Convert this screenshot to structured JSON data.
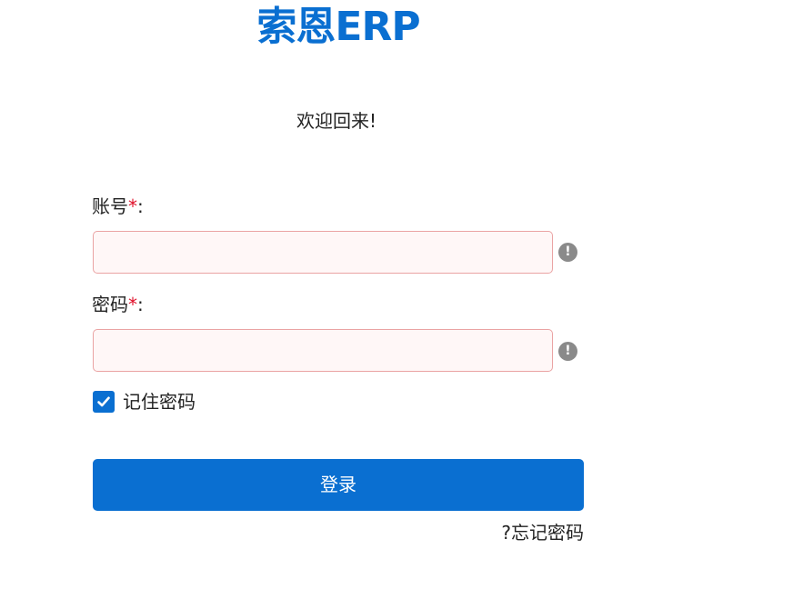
{
  "brand": {
    "title": "索恩ERP",
    "color": "#0a6fd1"
  },
  "welcome": "欢迎回来!",
  "form": {
    "account": {
      "label": "账号",
      "required_mark": "*",
      "colon": ":",
      "value": "",
      "status_icon": "exclamation-icon",
      "status_glyph": "!"
    },
    "password": {
      "label": "密码",
      "required_mark": "*",
      "colon": ":",
      "value": "",
      "status_icon": "exclamation-icon",
      "status_glyph": "!"
    },
    "remember": {
      "label": "记住密码",
      "checked": true,
      "icon": "checkmark-icon"
    },
    "login_button": "登录",
    "forgot_link": "?忘记密码"
  },
  "colors": {
    "primary": "#0a6fd1",
    "error_border": "#eaa3a3",
    "error_background": "#fff7f7",
    "required": "#e0102a",
    "warning_icon": "#8a8a8a"
  }
}
